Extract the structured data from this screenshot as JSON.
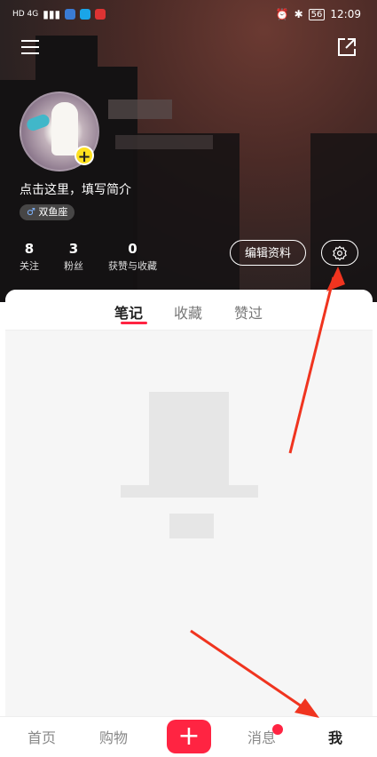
{
  "status_bar": {
    "left_text": "HD 4G",
    "time": "12:09",
    "battery": "56"
  },
  "profile": {
    "bio_placeholder": "点击这里，填写简介",
    "zodiac_tag": "双鱼座",
    "stats": [
      {
        "value": "8",
        "label": "关注"
      },
      {
        "value": "3",
        "label": "粉丝"
      },
      {
        "value": "0",
        "label": "获赞与收藏"
      }
    ],
    "edit_profile_label": "编辑资料"
  },
  "tabs": [
    {
      "label": "笔记",
      "active": true
    },
    {
      "label": "收藏",
      "active": false
    },
    {
      "label": "赞过",
      "active": false
    }
  ],
  "bottom_nav": {
    "home": "首页",
    "shop": "购物",
    "post": "+",
    "messages": "消息",
    "me": "我"
  },
  "colors": {
    "accent": "#ff2442",
    "badge_yellow": "#ffe11f",
    "annotation_arrow": "#f0341f"
  },
  "icons": [
    "menu-icon",
    "share-icon",
    "gear-icon",
    "plus-icon"
  ]
}
